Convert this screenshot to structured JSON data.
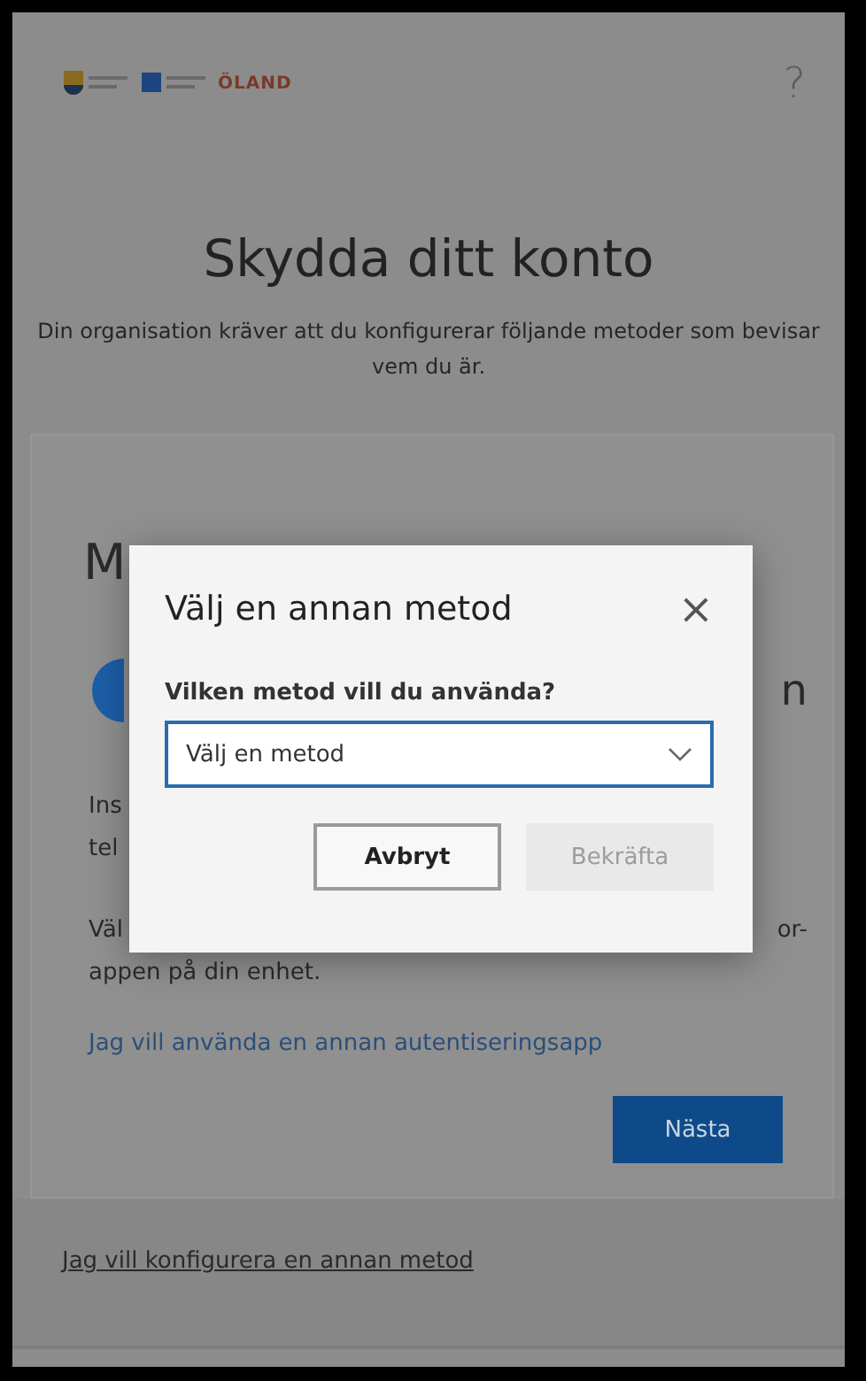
{
  "header": {
    "logo_text": "ÖLAND",
    "help": "?"
  },
  "page": {
    "title": "Skydda ditt konto",
    "subtitle": "Din organisation kräver att du konfigurerar följande metoder som bevisar vem du är."
  },
  "card": {
    "title_fragment": "M",
    "heading_fragment": "n",
    "fragments": [
      "Ins",
      "tel"
    ],
    "row_left": "Väl",
    "row_right": "or-",
    "line": "appen på din enhet.",
    "link": "Jag vill använda en annan autentiseringsapp",
    "next_button": "Nästa"
  },
  "footer_link": "Jag vill konfigurera en annan metod",
  "dialog": {
    "title": "Välj en annan metod",
    "close": "×",
    "label": "Vilken metod vill du använda?",
    "select": {
      "value": "Välj en metod",
      "focused": true
    },
    "buttons": [
      {
        "label": "Avbryt",
        "disabled": false
      },
      {
        "label": "Bekräfta",
        "disabled": true
      }
    ]
  }
}
